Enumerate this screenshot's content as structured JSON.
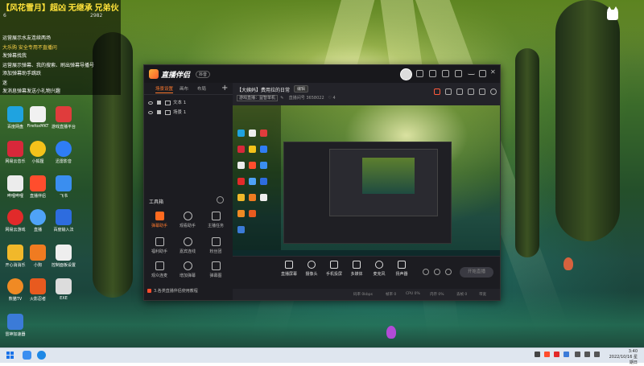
{
  "overlay": {
    "stream_title": "【风花雪月】超凶 无继承 兄弟伙",
    "stats": [
      "6",
      "2982"
    ],
    "chat": [
      {
        "text": "运营展示水友连续两场",
        "style": "w"
      },
      {
        "text": "  大乐购   安全专用不直播问",
        "style": "y"
      },
      {
        "text": "发弹幕找我",
        "style": "w"
      },
      {
        "text": "运营展示弹幕、我的搜索、刷出弹幕导播号",
        "style": "w"
      },
      {
        "text": "添加弹幕助手跳跃",
        "style": "w"
      },
      {
        "text": "迷",
        "style": "w"
      },
      {
        "text": "发消息弹幕发送小礼物兴趣",
        "style": "w"
      }
    ]
  },
  "desktop_icons": [
    {
      "label": "百度网盘"
    },
    {
      "label": "FirefoxMKT"
    },
    {
      "label": "游戏直播平台"
    },
    {
      "label": "网易云音乐"
    },
    {
      "label": "小狐狸"
    },
    {
      "label": "迅雷影音"
    },
    {
      "label": "哔哩哔哩"
    },
    {
      "label": "直播伴侣"
    },
    {
      "label": "飞书"
    },
    {
      "label": "网易云游戏"
    },
    {
      "label": "直播"
    },
    {
      "label": "百度输入法"
    },
    {
      "label": "开心消消乐"
    },
    {
      "label": "小狗"
    },
    {
      "label": "控制面板设置"
    },
    {
      "label": "熊猫TV"
    },
    {
      "label": "火影忍者"
    },
    {
      "label": "EXE"
    },
    {
      "label": "雷神加速器"
    }
  ],
  "app": {
    "name": "直播伴侣",
    "badge": "抖音",
    "left_tabs": [
      "场景设置",
      "画布",
      "布局"
    ],
    "scenes": [
      "文本 1",
      "场景 1"
    ],
    "tools_header": "工具箱",
    "tools": [
      {
        "label": "弹幕助手",
        "hot": true
      },
      {
        "label": "观看助手",
        "hot": false
      },
      {
        "label": "主播任务",
        "hot": false
      },
      {
        "label": "福利助手",
        "hot": false
      },
      {
        "label": "嘉宾连线",
        "hot": false
      },
      {
        "label": "粉丝团",
        "hot": false
      },
      {
        "label": "观众连麦",
        "hot": false
      },
      {
        "label": "增加弹幕",
        "hot": false
      },
      {
        "label": "弹幕图",
        "hot": false
      }
    ],
    "hint": "3.各类直播伴侣使用教程",
    "room_title": "【大姨妈】费用拉的日常",
    "edit_label": "编辑",
    "room_category": "游戏直播：益智单机",
    "room_id_label": "直播间号",
    "room_id": "3658022",
    "likes": "4",
    "controls": [
      "直播屏幕",
      "摄像头",
      "手机投屏",
      "多媒体",
      "麦克风",
      "扬声器"
    ],
    "start_label": "开始直播",
    "status": [
      "码率 0kbps",
      "帧率 0",
      "CPU 0%",
      "内存 0%",
      "丢帧 0",
      "带宽"
    ]
  },
  "taskbar": {
    "time": "3:40",
    "date": "2022/10/16 星期日"
  }
}
